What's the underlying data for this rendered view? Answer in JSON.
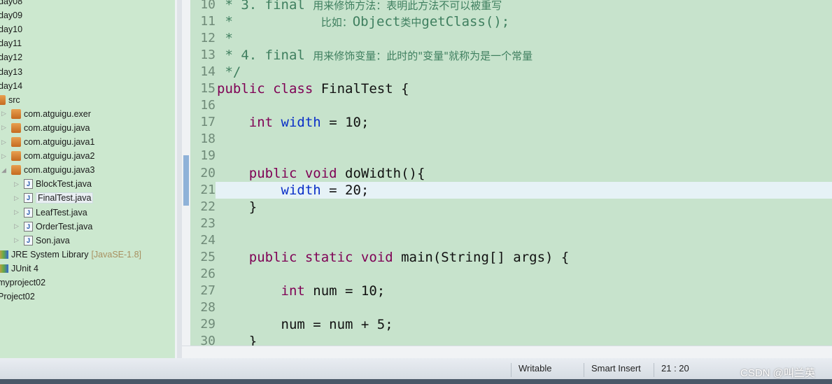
{
  "explorer": {
    "items": [
      {
        "label": "day08",
        "indent": 0,
        "type": "folder"
      },
      {
        "label": "day09",
        "indent": 0,
        "type": "folder"
      },
      {
        "label": "day10",
        "indent": 0,
        "type": "folder"
      },
      {
        "label": "day11",
        "indent": 0,
        "type": "folder"
      },
      {
        "label": "day12",
        "indent": 0,
        "type": "folder"
      },
      {
        "label": "day13",
        "indent": 0,
        "type": "folder"
      },
      {
        "label": "day14",
        "indent": 0,
        "type": "folder"
      },
      {
        "label": "src",
        "indent": 0,
        "type": "src"
      },
      {
        "label": "com.atguigu.exer",
        "indent": 1,
        "type": "pkg"
      },
      {
        "label": "com.atguigu.java",
        "indent": 1,
        "type": "pkg"
      },
      {
        "label": "com.atguigu.java1",
        "indent": 1,
        "type": "pkg"
      },
      {
        "label": "com.atguigu.java2",
        "indent": 1,
        "type": "pkg"
      },
      {
        "label": "com.atguigu.java3",
        "indent": 1,
        "type": "pkg",
        "expanded": true
      },
      {
        "label": "BlockTest.java",
        "indent": 2,
        "type": "java"
      },
      {
        "label": "FinalTest.java",
        "indent": 2,
        "type": "java",
        "selected": true
      },
      {
        "label": "LeafTest.java",
        "indent": 2,
        "type": "java"
      },
      {
        "label": "OrderTest.java",
        "indent": 2,
        "type": "java"
      },
      {
        "label": "Son.java",
        "indent": 2,
        "type": "java"
      },
      {
        "label": "JRE System Library",
        "extra": "[JavaSE-1.8]",
        "indent": 0,
        "type": "lib"
      },
      {
        "label": "JUnit 4",
        "indent": 0,
        "type": "lib"
      },
      {
        "label": "myproject02",
        "indent": -1,
        "type": "project"
      },
      {
        "label": "Project02",
        "indent": -1,
        "type": "project"
      }
    ]
  },
  "editor": {
    "current_line": 21,
    "lines": [
      {
        "n": "10",
        "html": "<span class='cm'> * 3. final <span class='cn'>用来修饰方法：表明此方法不可以被重写</span></span>"
      },
      {
        "n": "11",
        "html": "<span class='cm'> *           <span class='cn'>比如：</span>Object<span class='cn'>类中</span>getClass();</span>"
      },
      {
        "n": "12",
        "html": "<span class='cm'> *</span>"
      },
      {
        "n": "13",
        "html": "<span class='cm'> * 4. final <span class='cn'>用来修饰变量：此时的\"变量\"就称为是一个常量</span></span>"
      },
      {
        "n": "14",
        "html": "<span class='cm'> */</span>"
      },
      {
        "n": "15",
        "html": "<span class='kw'>public class</span> FinalTest {"
      },
      {
        "n": "16",
        "html": ""
      },
      {
        "n": "17",
        "html": "    <span class='kw'>int</span> <span class='fd'>width</span> = 10;"
      },
      {
        "n": "18",
        "html": ""
      },
      {
        "n": "19",
        "html": ""
      },
      {
        "n": "20",
        "html": "    <span class='kw'>public void</span> doWidth(){"
      },
      {
        "n": "21",
        "html": "        <span class='fd'>width</span> = 20;"
      },
      {
        "n": "22",
        "html": "    }"
      },
      {
        "n": "23",
        "html": ""
      },
      {
        "n": "24",
        "html": ""
      },
      {
        "n": "25",
        "html": "    <span class='kw'>public static void</span> main(String[] args) {"
      },
      {
        "n": "26",
        "html": ""
      },
      {
        "n": "27",
        "html": "        <span class='kw'>int</span> num = 10;"
      },
      {
        "n": "28",
        "html": ""
      },
      {
        "n": "29",
        "html": "        num = num + 5;"
      },
      {
        "n": "30",
        "html": "    }"
      }
    ]
  },
  "status": {
    "writable": "Writable",
    "insert_mode": "Smart Insert",
    "position": "21 : 20"
  },
  "watermark": "CSDN @叫兰英",
  "colors": {
    "editor_bg": "#c7e3cc",
    "keyword": "#7f0055",
    "field": "#0a2fc8",
    "comment": "#3f7f5f"
  }
}
